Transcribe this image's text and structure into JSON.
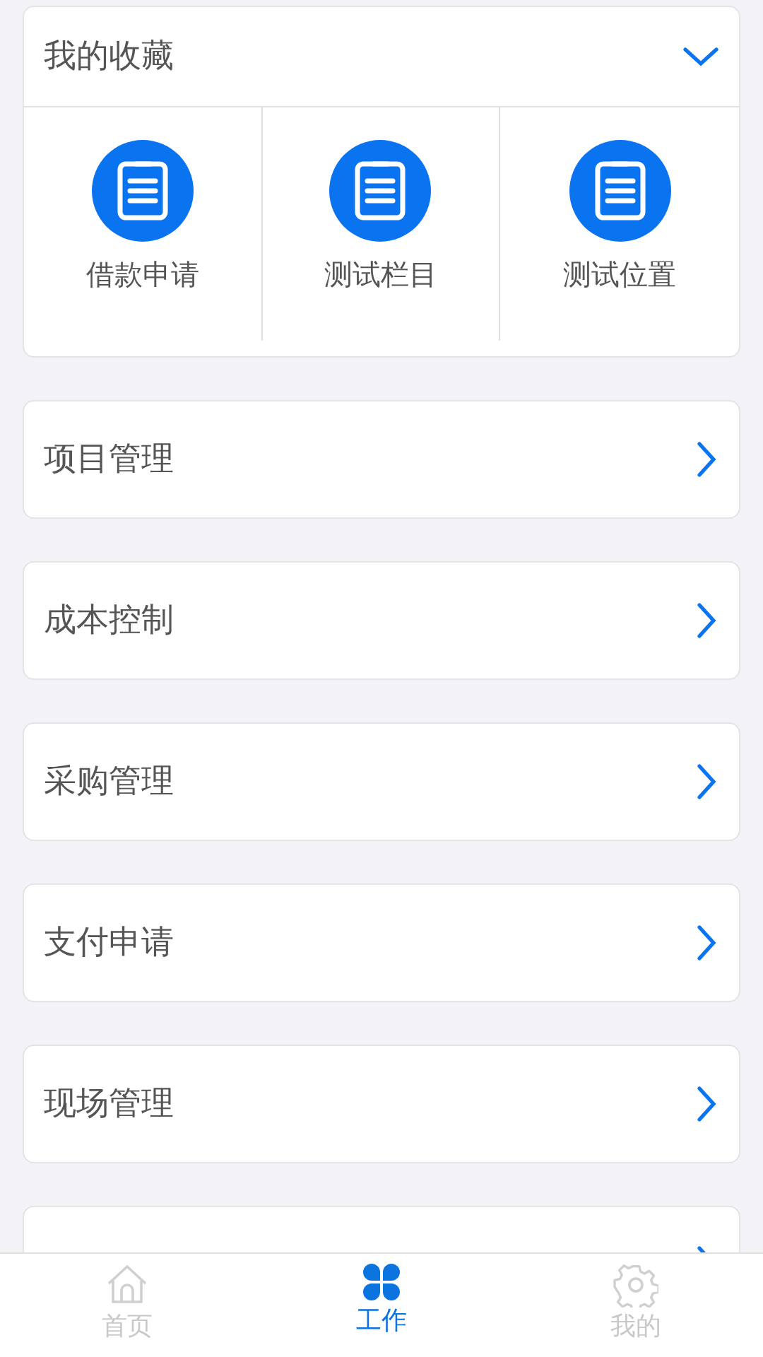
{
  "favorites": {
    "title": "我的收藏",
    "expanded": true,
    "items": [
      {
        "label": "借款申请"
      },
      {
        "label": "测试栏目"
      },
      {
        "label": "测试位置"
      }
    ]
  },
  "menu": [
    {
      "label": "项目管理"
    },
    {
      "label": "成本控制"
    },
    {
      "label": "采购管理"
    },
    {
      "label": "支付申请"
    },
    {
      "label": "现场管理"
    },
    {
      "cut_off": true
    }
  ],
  "tab_bar": [
    {
      "label": "首页",
      "kind": "home",
      "selected": false
    },
    {
      "label": "工作",
      "kind": "work",
      "selected": true
    },
    {
      "label": "我的",
      "kind": "settings",
      "selected": false
    }
  ]
}
